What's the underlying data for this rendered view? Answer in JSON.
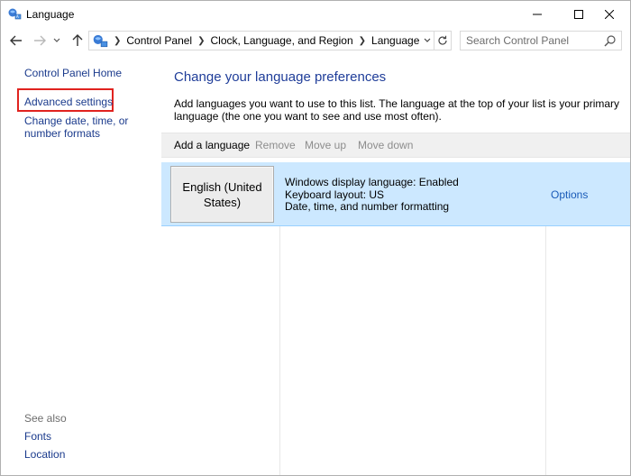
{
  "window": {
    "title": "Language",
    "icon": "control-panel-icon",
    "controls": [
      "minimize",
      "maximize",
      "close"
    ]
  },
  "nav": {
    "back_icon": "arrow-left-icon",
    "forward_icon": "arrow-right-icon",
    "recent_icon": "chevron-down-icon",
    "up_icon": "arrow-up-icon"
  },
  "address": {
    "crumbs": [
      "Control Panel",
      "Clock, Language, and Region",
      "Language"
    ]
  },
  "search": {
    "placeholder": "Search Control Panel"
  },
  "left_pane": {
    "home": "Control Panel Home",
    "advanced": "Advanced settings",
    "date_time": "Change date, time, or number formats",
    "see_also": "See also",
    "fonts": "Fonts",
    "location": "Location"
  },
  "main": {
    "heading": "Change your language preferences",
    "description": "Add languages you want to use to this list. The language at the top of your list is your primary language (the one you want to see and use most often).",
    "toolbar": {
      "add": "Add a language",
      "remove": "Remove",
      "move_up": "Move up",
      "move_down": "Move down"
    },
    "languages": [
      {
        "name": "English (United States)",
        "info": [
          "Windows display language: Enabled",
          "Keyboard layout: US",
          "Date, time, and number formatting"
        ],
        "options": "Options"
      }
    ]
  },
  "colors": {
    "link": "#1a3a8c",
    "heading": "#1f3d99",
    "selected_row": "#cce8ff",
    "highlight_box": "#e0231f"
  }
}
